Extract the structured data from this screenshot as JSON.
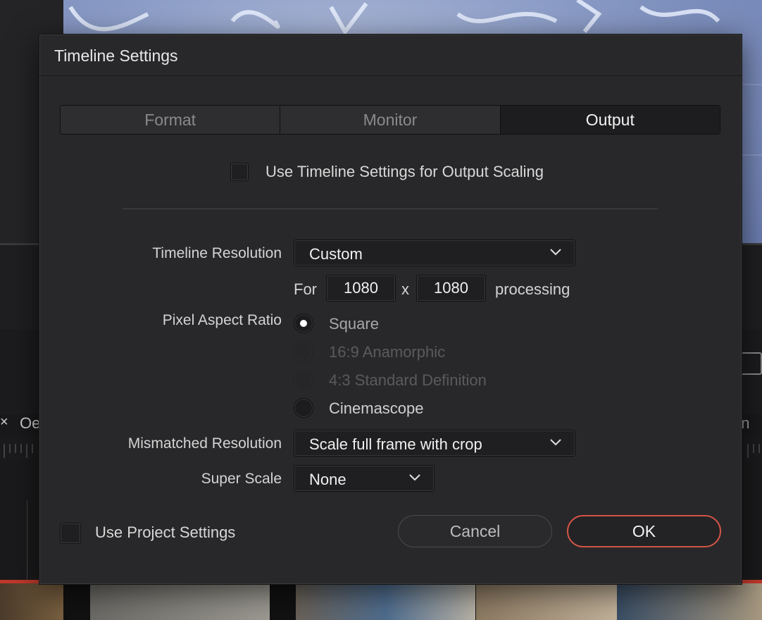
{
  "dialog": {
    "title": "Timeline Settings",
    "tabs": [
      {
        "label": "Format",
        "active": false
      },
      {
        "label": "Monitor",
        "active": false
      },
      {
        "label": "Output",
        "active": true
      }
    ],
    "use_timeline_output_scaling": {
      "label": "Use Timeline Settings for Output Scaling",
      "checked": false
    },
    "timeline_resolution": {
      "label": "Timeline Resolution",
      "value": "Custom",
      "for_label": "For",
      "width": "1080",
      "x_label": "x",
      "height": "1080",
      "processing_label": "processing"
    },
    "pixel_aspect_ratio": {
      "label": "Pixel Aspect Ratio",
      "options": [
        {
          "label": "Square",
          "selected": true,
          "enabled": true
        },
        {
          "label": "16:9 Anamorphic",
          "selected": false,
          "enabled": false
        },
        {
          "label": "4:3 Standard Definition",
          "selected": false,
          "enabled": false
        },
        {
          "label": "Cinemascope",
          "selected": false,
          "enabled": true
        }
      ]
    },
    "mismatched_resolution": {
      "label": "Mismatched Resolution",
      "value": "Scale full frame with crop"
    },
    "super_scale": {
      "label": "Super Scale",
      "value": "None"
    },
    "use_project_settings": {
      "label": "Use Project Settings",
      "checked": false
    },
    "buttons": {
      "cancel": "Cancel",
      "ok": "OK"
    }
  },
  "background": {
    "left_close": "×",
    "left_track_text": "Oe",
    "right_track_text": "en"
  },
  "colors": {
    "ok_border": "#d35446",
    "playhead_red": "#c0392b",
    "dialog_bg": "#28282a"
  },
  "icons": [
    "chevron-down-icon",
    "close-icon"
  ]
}
